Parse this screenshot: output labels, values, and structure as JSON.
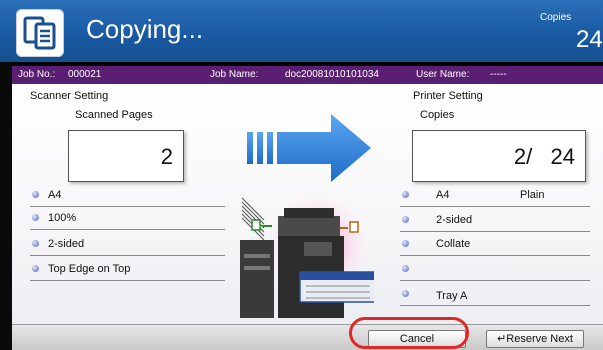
{
  "header": {
    "title": "Copying...",
    "copies_label": "Copies",
    "copies_value": "24",
    "icon": "copy-document-icon"
  },
  "job": {
    "job_no_label": "Job No.:",
    "job_no": "000021",
    "job_name_label": "Job Name:",
    "job_name": "doc20081010101034",
    "user_name_label": "User Name:",
    "user_name": "-----"
  },
  "scanner": {
    "heading": "Scanner Setting",
    "pages_label": "Scanned Pages",
    "pages_value": "2",
    "settings": [
      "A4",
      "100%",
      "2-sided",
      "Top Edge on Top"
    ]
  },
  "printer": {
    "heading": "Printer Setting",
    "copies_label": "Copies",
    "copies_value": "2/   24",
    "settings": [
      {
        "left": "A4",
        "right": "Plain"
      },
      {
        "left": "2-sided",
        "right": ""
      },
      {
        "left": "Collate",
        "right": ""
      },
      {
        "left": "",
        "right": ""
      },
      {
        "left": "Tray A",
        "right": ""
      }
    ]
  },
  "buttons": {
    "cancel": "Cancel",
    "reserve_next": "Reserve Next"
  },
  "colors": {
    "header": "#1a5aa3",
    "job_bar": "#5a1f73",
    "highlight_ring": "#e0282a",
    "arrow": "#2f7fd6"
  }
}
